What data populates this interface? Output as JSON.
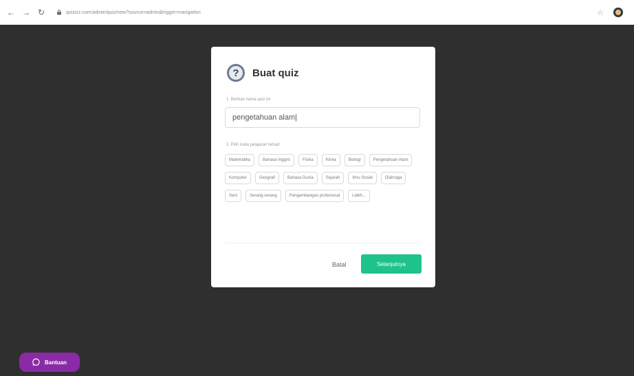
{
  "browser": {
    "url": "quizizz.com/admin/quiz/new?source=admin&trigger=navigation",
    "icons": [
      "back-icon",
      "forward-icon",
      "reload-icon",
      "lock-icon",
      "star-icon",
      "profile-avatar"
    ]
  },
  "modal": {
    "title": "Buat quiz",
    "step1_label": "1. Berikan nama quiz ini",
    "quiz_name_value": "pengetahuan alam|",
    "step2_label": "2. Pilih mata pelajaran terkait",
    "subjects": [
      "Matematika",
      "Bahasa Inggris",
      "Fisika",
      "Kimia",
      "Biologi",
      "Pengetahuan Alam",
      "Komputer",
      "Geografi",
      "Bahasa Dunia",
      "Sejarah",
      "Ilmu Sosial",
      "Olahraga",
      "Seni",
      "Serang-serang",
      "Pengembangan profesional",
      "Lebih..."
    ],
    "cancel_label": "Batal",
    "next_label": "Selanjutnya"
  },
  "help": {
    "label": "Bantuan"
  },
  "colors": {
    "background": "#2f2f2f",
    "primary": "#1ec28b",
    "help": "#8b2aa6"
  }
}
